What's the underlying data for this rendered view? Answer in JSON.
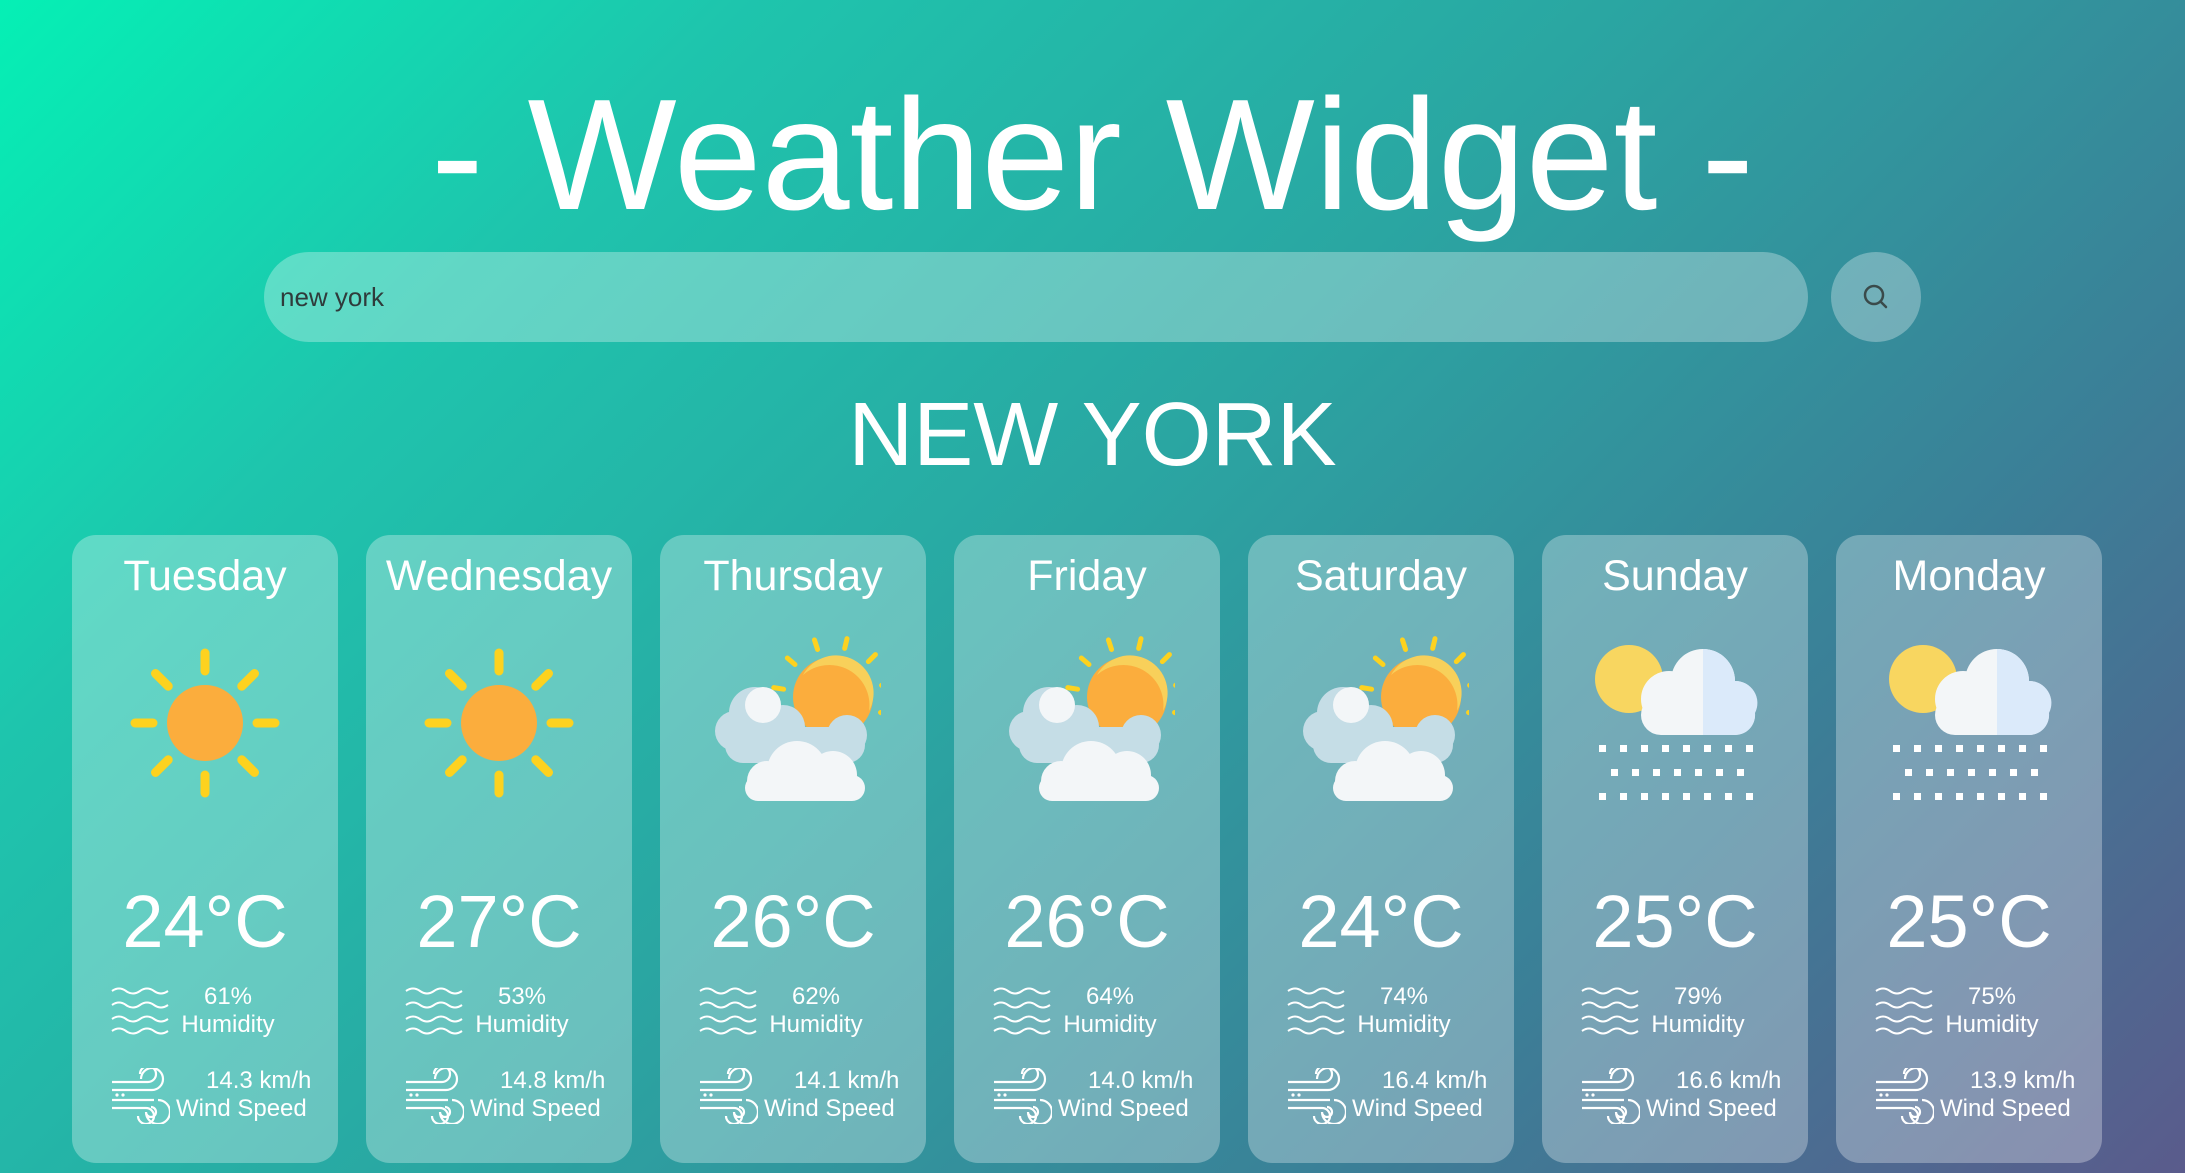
{
  "app": {
    "title": "- Weather Widget -"
  },
  "search": {
    "value": "new york",
    "button_icon": "search-icon"
  },
  "city": "NEW YORK",
  "forecast": [
    {
      "day": "Tuesday",
      "icon": "sun-icon",
      "temp": "24°C",
      "humidity": "61%",
      "humidity_label": "Humidity",
      "wind": "14.3 km/h",
      "wind_label": "Wind Speed"
    },
    {
      "day": "Wednesday",
      "icon": "sun-icon",
      "temp": "27°C",
      "humidity": "53%",
      "humidity_label": "Humidity",
      "wind": "14.8 km/h",
      "wind_label": "Wind Speed"
    },
    {
      "day": "Thursday",
      "icon": "partly-cloudy-icon",
      "temp": "26°C",
      "humidity": "62%",
      "humidity_label": "Humidity",
      "wind": "14.1 km/h",
      "wind_label": "Wind Speed"
    },
    {
      "day": "Friday",
      "icon": "partly-cloudy-icon",
      "temp": "26°C",
      "humidity": "64%",
      "humidity_label": "Humidity",
      "wind": "14.0 km/h",
      "wind_label": "Wind Speed"
    },
    {
      "day": "Saturday",
      "icon": "partly-cloudy-icon",
      "temp": "24°C",
      "humidity": "74%",
      "humidity_label": "Humidity",
      "wind": "16.4 km/h",
      "wind_label": "Wind Speed"
    },
    {
      "day": "Sunday",
      "icon": "snow-icon",
      "temp": "25°C",
      "humidity": "79%",
      "humidity_label": "Humidity",
      "wind": "16.6 km/h",
      "wind_label": "Wind Speed"
    },
    {
      "day": "Monday",
      "icon": "snow-icon",
      "temp": "25°C",
      "humidity": "75%",
      "humidity_label": "Humidity",
      "wind": "13.9 km/h",
      "wind_label": "Wind Speed"
    }
  ],
  "colors": {
    "sun": "#fbad3d",
    "sun_rays": "#fdd21f",
    "cloud": "#f3f6f8",
    "cloud_shade": "#c5dde6"
  }
}
